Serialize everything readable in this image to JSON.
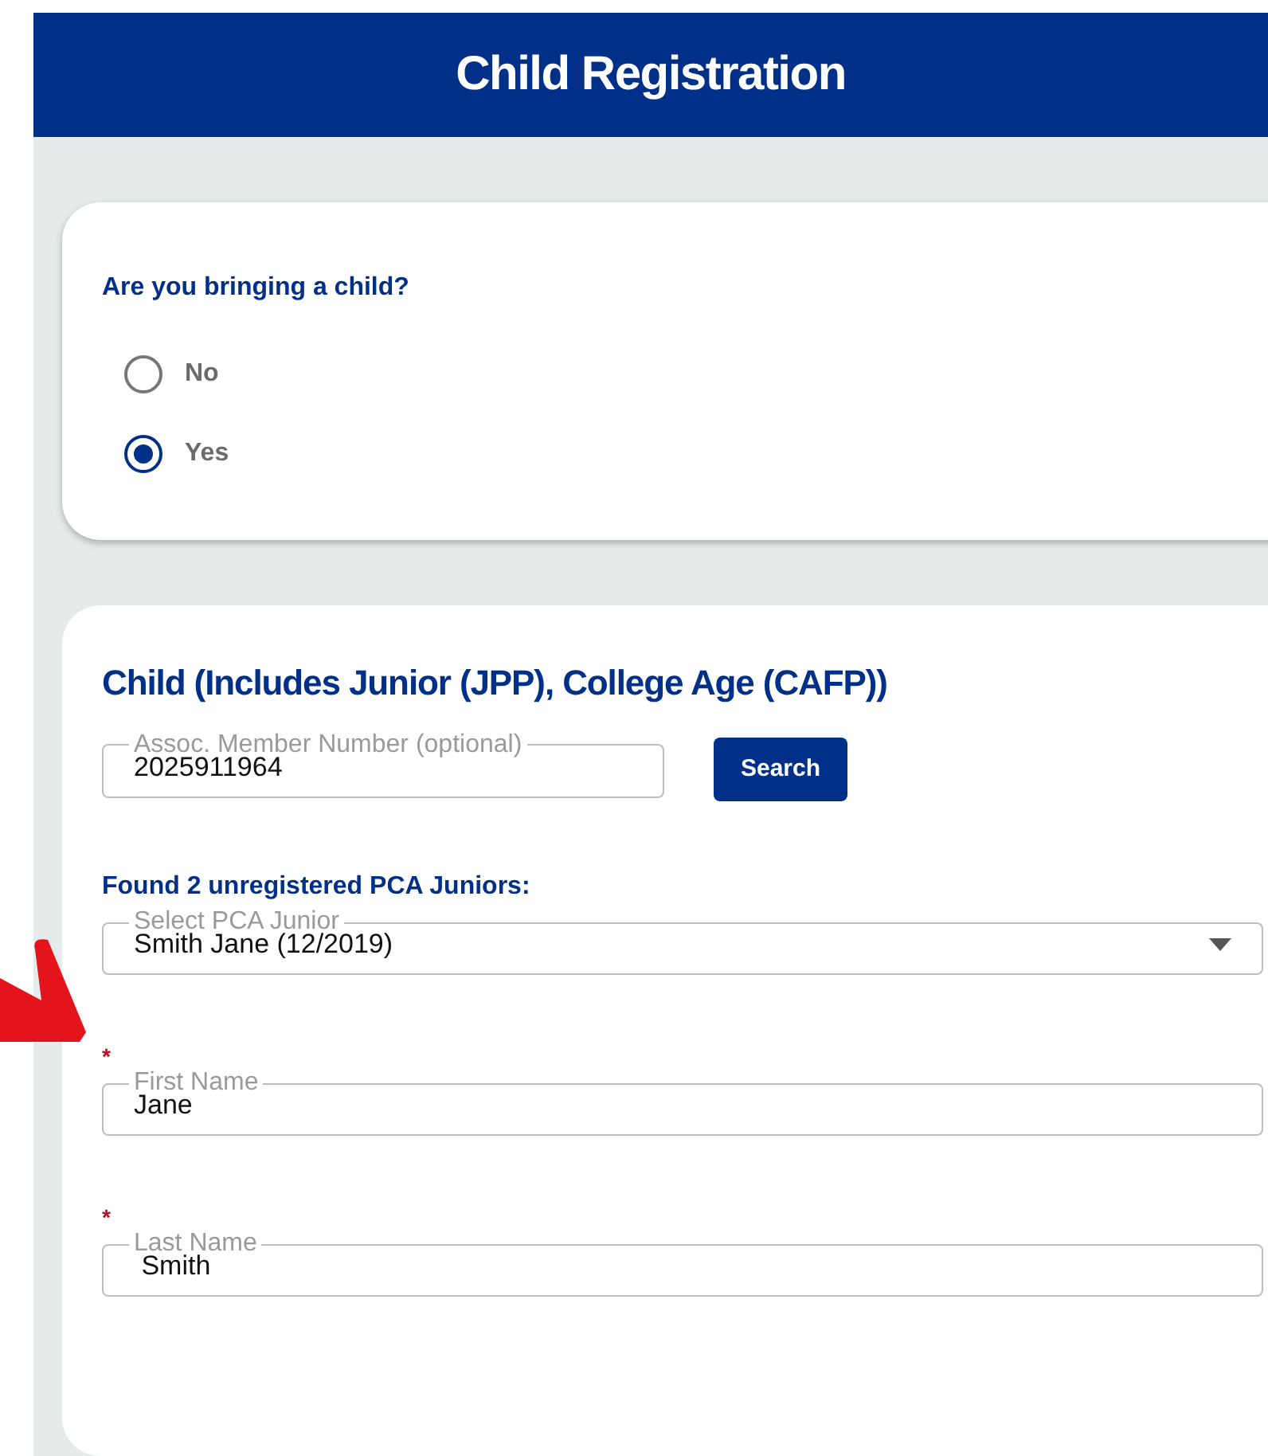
{
  "header": {
    "title": "Child Registration"
  },
  "question_card": {
    "question": "Are you bringing a child?",
    "options": [
      {
        "label": "No",
        "selected": false
      },
      {
        "label": "Yes",
        "selected": true
      }
    ]
  },
  "child_card": {
    "title": "Child (Includes Junior (JPP), College Age (CAFP))",
    "member_field": {
      "label": "Assoc. Member Number (optional)",
      "value": "2025911964"
    },
    "search_button": "Search",
    "found_text": "Found 2 unregistered PCA Juniors:",
    "select": {
      "label": "Select PCA Junior",
      "value": "Smith Jane (12/2019)"
    },
    "fields": [
      {
        "label": "First Name",
        "value": "Jane",
        "required": true,
        "required_mark": "*"
      },
      {
        "label": "Last Name",
        "value": " Smith",
        "required": true,
        "required_mark": "*"
      }
    ]
  }
}
